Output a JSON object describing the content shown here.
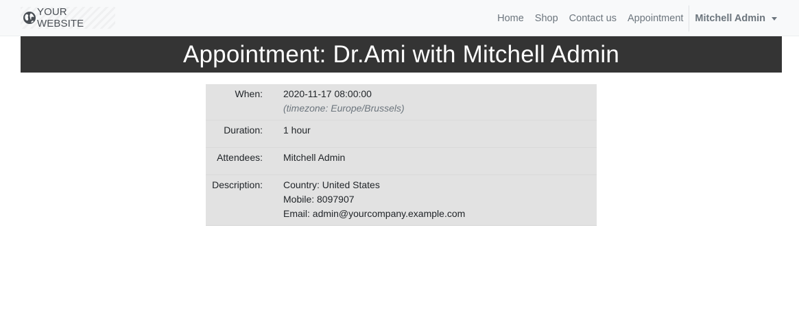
{
  "navbar": {
    "brand": "YOUR WEBSITE",
    "brand_icon": "globe-icon",
    "links": [
      "Home",
      "Shop",
      "Contact us",
      "Appointment"
    ],
    "user": "Mitchell Admin"
  },
  "banner": {
    "title": "Appointment: Dr.Ami with Mitchell Admin"
  },
  "details": {
    "when_label": "When:",
    "when_value": "2020-11-17 08:00:00",
    "timezone": "(timezone: Europe/Brussels)",
    "duration_label": "Duration:",
    "duration_value": "1 hour",
    "attendees_label": "Attendees:",
    "attendees_value": "Mitchell Admin",
    "description_label": "Description:",
    "description_lines": [
      "Country: United States",
      "Mobile: 8097907",
      "Email: admin@yourcompany.example.com"
    ]
  },
  "colors": {
    "navbar_bg": "#f8f9fa",
    "banner_bg": "#343434",
    "details_bg": "#e2e2e2",
    "nav_text": "#6c757d"
  }
}
